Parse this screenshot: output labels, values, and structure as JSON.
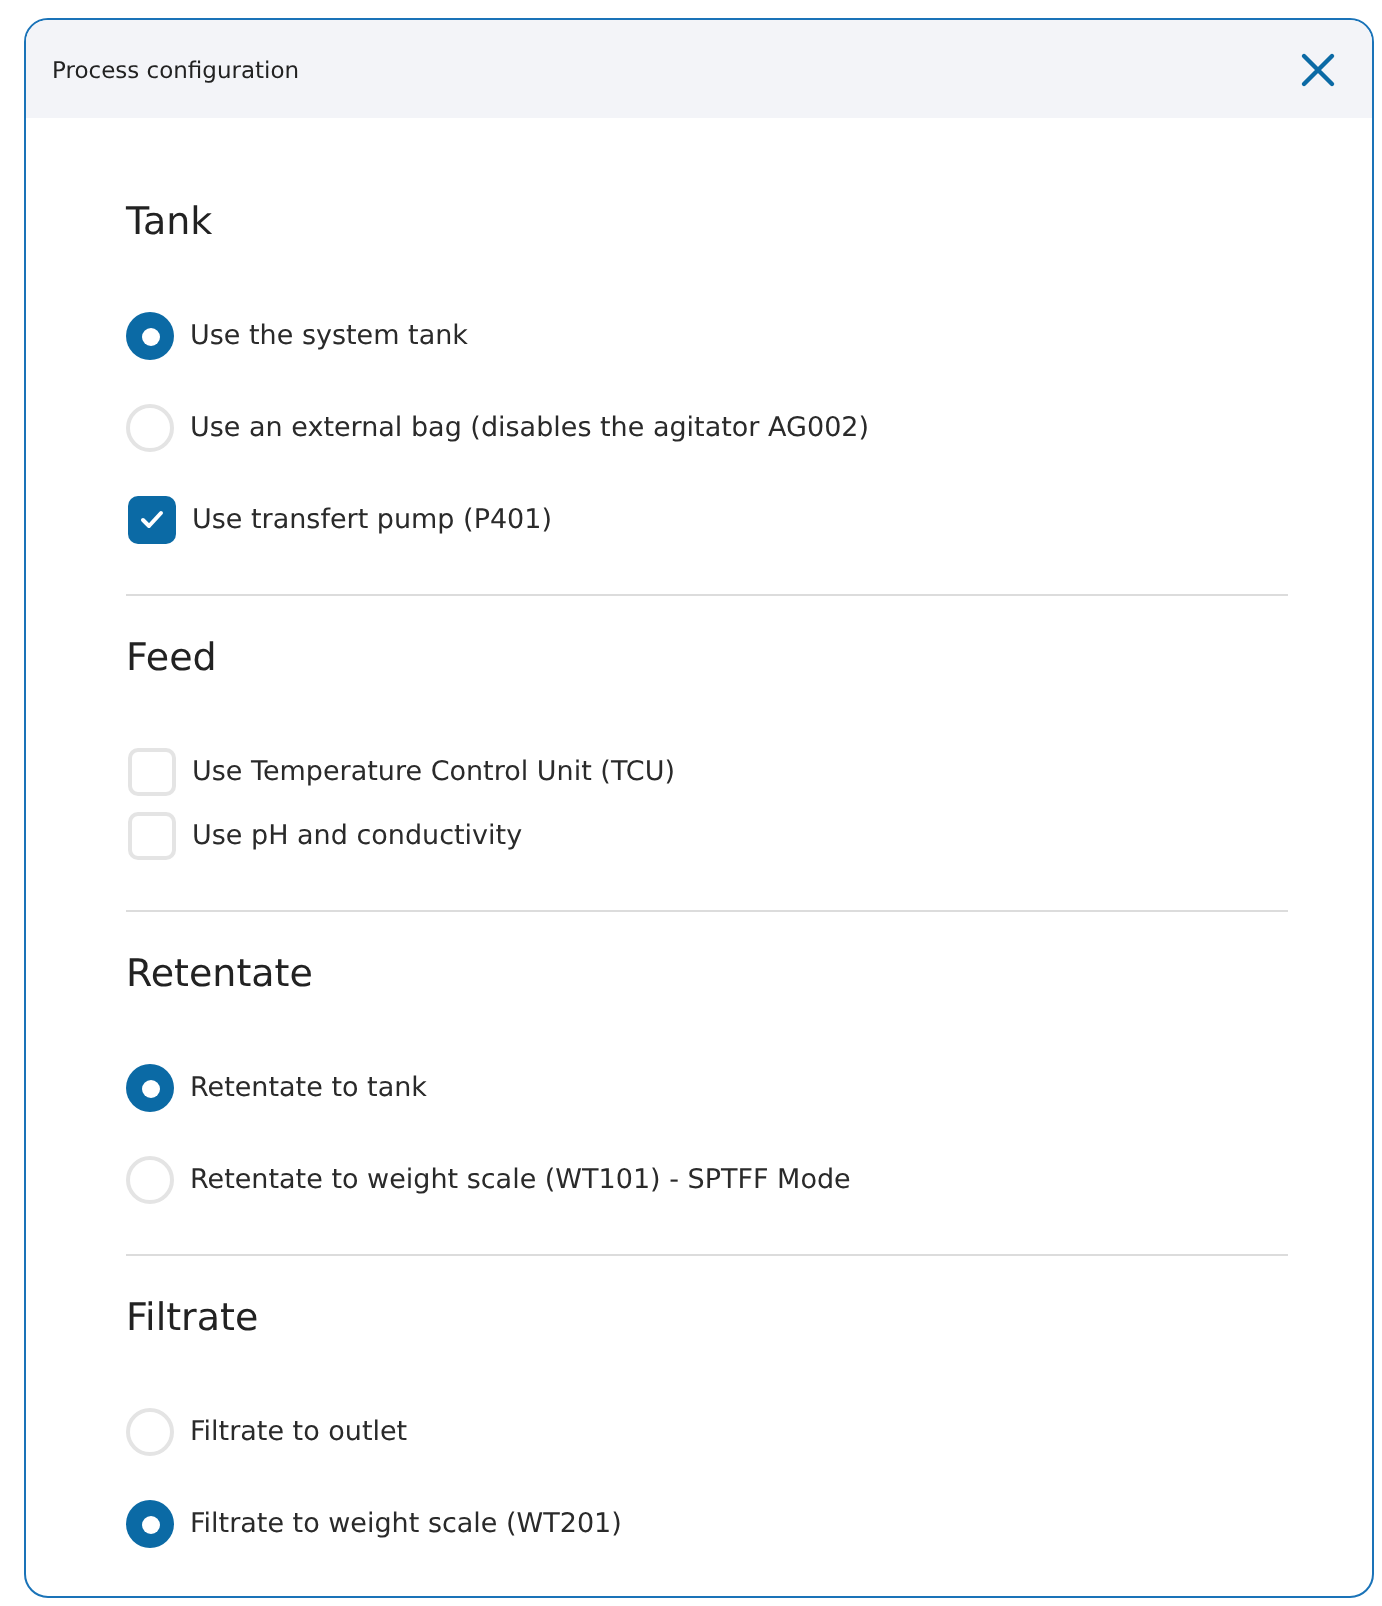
{
  "dialog": {
    "title": "Process configuration"
  },
  "sections": [
    {
      "heading": "Tank",
      "options": [
        {
          "kind": "radio",
          "label": "Use the system tank",
          "checked": true
        },
        {
          "kind": "radio",
          "label": "Use an external bag (disables the agitator AG002)",
          "checked": false
        },
        {
          "kind": "checkbox",
          "label": "Use transfert pump (P401)",
          "checked": true
        }
      ]
    },
    {
      "heading": "Feed",
      "options": [
        {
          "kind": "checkbox",
          "label": "Use Temperature Control Unit (TCU)",
          "checked": false
        },
        {
          "kind": "checkbox",
          "label": "Use pH and conductivity",
          "checked": false
        }
      ]
    },
    {
      "heading": "Retentate",
      "options": [
        {
          "kind": "radio",
          "label": "Retentate to tank",
          "checked": true
        },
        {
          "kind": "radio",
          "label": "Retentate to weight scale (WT101) - SPTFF Mode",
          "checked": false
        }
      ]
    },
    {
      "heading": "Filtrate",
      "options": [
        {
          "kind": "radio",
          "label": "Filtrate to outlet",
          "checked": false
        },
        {
          "kind": "radio",
          "label": "Filtrate to weight scale (WT201)",
          "checked": true
        }
      ]
    }
  ]
}
